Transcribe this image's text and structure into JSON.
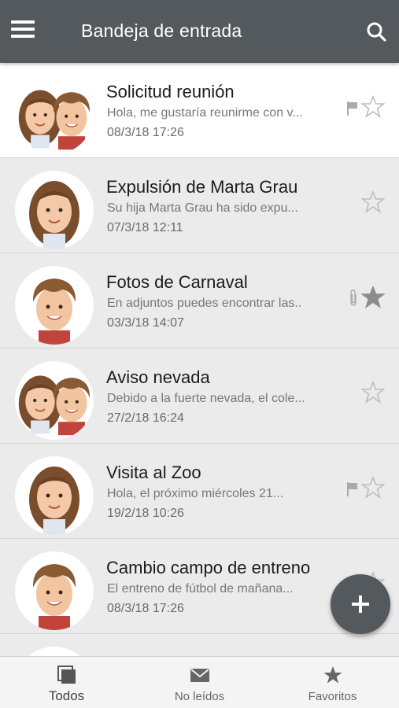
{
  "appbar": {
    "title": "Bandeja de entrada",
    "menu_icon": "menu-icon",
    "search_icon": "search-icon"
  },
  "messages": [
    {
      "subject": "Solicitud reunión",
      "preview": "Hola, me gustaría reunirme con v...",
      "date": "08/3/18  17:26",
      "avatar": "both",
      "flag": true,
      "attachment": false,
      "starred": false
    },
    {
      "subject": "Expulsión de Marta Grau",
      "preview": "Su hija Marta Grau ha sido expu...",
      "date": "07/3/18  12:11",
      "avatar": "girl",
      "flag": false,
      "attachment": false,
      "starred": false
    },
    {
      "subject": "Fotos de Carnaval",
      "preview": "En adjuntos puedes encontrar las..",
      "date": "03/3/18  14:07",
      "avatar": "boy",
      "flag": false,
      "attachment": true,
      "starred": true
    },
    {
      "subject": "Aviso nevada",
      "preview": "Debido a la fuerte nevada, el cole...",
      "date": "27/2/18  16:24",
      "avatar": "both",
      "flag": false,
      "attachment": false,
      "starred": false
    },
    {
      "subject": "Visita al Zoo",
      "preview": "Hola, el próximo miércoles 21...",
      "date": "19/2/18  10:26",
      "avatar": "girl",
      "flag": true,
      "attachment": false,
      "starred": false
    },
    {
      "subject": "Cambio campo de entreno",
      "preview": "El entreno de fútbol de mañana...",
      "date": "08/3/18  17:26",
      "avatar": "boy",
      "flag": false,
      "attachment": false,
      "starred": false
    },
    {
      "subject": "",
      "preview": "",
      "date": "",
      "avatar": "girl",
      "flag": false,
      "attachment": false,
      "starred": false
    }
  ],
  "fab": {
    "icon": "plus-icon"
  },
  "tabs": [
    {
      "label": "Todos",
      "icon": "inbox-stack-icon",
      "active": true
    },
    {
      "label": "No leídos",
      "icon": "envelope-icon",
      "active": false
    },
    {
      "label": "Favoritos",
      "icon": "star-icon",
      "active": false
    }
  ],
  "colors": {
    "appbar": "#54595d",
    "row_bg": "#ebebeb",
    "row_selected": "#ffffff",
    "star_outline": "#bdbdbd",
    "star_filled": "#8c8c8c"
  }
}
